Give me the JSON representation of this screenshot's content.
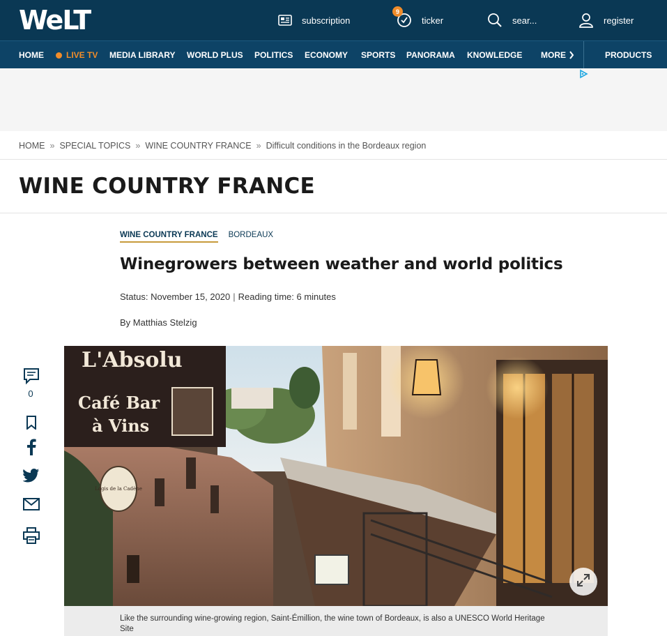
{
  "brand": {
    "logo": "WeLT"
  },
  "header": {
    "subscription_label": "subscription",
    "ticker_label": "ticker",
    "ticker_badge": "9",
    "search_label": "sear...",
    "register_label": "register"
  },
  "nav": {
    "items": [
      "HOME",
      "LIVE TV",
      "MEDIA LIBRARY",
      "WORLD PLUS",
      "POLITICS",
      "ECONOMY",
      "SPORTS",
      "PANORAMA",
      "KNOWLEDGE",
      "MORE"
    ],
    "products": "PRODUCTS"
  },
  "breadcrumb": {
    "items": [
      "HOME",
      "SPECIAL TOPICS",
      "WINE COUNTRY FRANCE",
      "Difficult conditions in the Bordeaux region"
    ],
    "separator": "»"
  },
  "section": {
    "title": "WINE COUNTRY FRANCE"
  },
  "article": {
    "tag_main": "WINE COUNTRY FRANCE",
    "tag_sub": "BORDEAUX",
    "headline": "Winegrowers between weather and world politics",
    "status": "Status: November 15, 2020",
    "reading_time": "Reading time: 6 minutes",
    "author": "By Matthias Stelzig",
    "comment_count": "0",
    "image_signs": {
      "sign_top": "L'Absolu",
      "sign_line1": "Café Bar",
      "sign_line2": "à Vins",
      "oval_sign": "Logis de la Cadène"
    },
    "caption": "Like the surrounding wine-growing region, Saint-Émillion, the wine town of Bordeaux, is also a UNESCO World Heritage Site"
  },
  "colors": {
    "topbar": "#0a3854",
    "navbar": "#0d4366",
    "live": "#f08c2a",
    "accent_underline": "#c79a3b"
  },
  "icons": [
    "newspaper-icon",
    "clock-icon",
    "search-icon",
    "user-icon",
    "chevron-right-icon",
    "adchoices-icon",
    "comment-icon",
    "bookmark-icon",
    "facebook-icon",
    "twitter-icon",
    "mail-icon",
    "print-icon",
    "expand-icon"
  ]
}
